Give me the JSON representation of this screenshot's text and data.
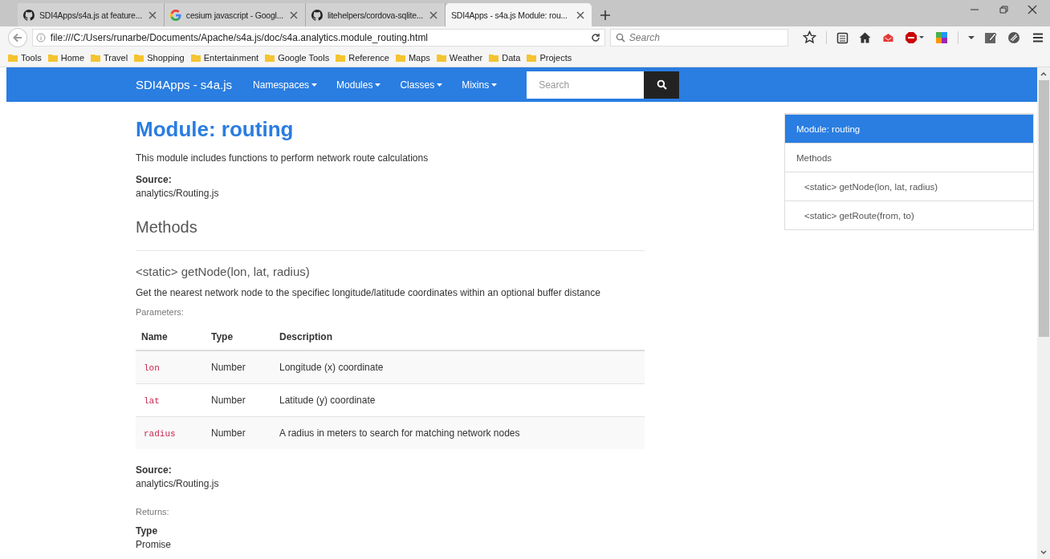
{
  "browser": {
    "tabs": [
      {
        "title": "SDI4Apps/s4a.js at feature...",
        "kind": "github",
        "selected": false
      },
      {
        "title": "cesium javascript - Googl...",
        "kind": "google",
        "selected": false
      },
      {
        "title": "litehelpers/cordova-sqlite...",
        "kind": "github",
        "selected": false
      },
      {
        "title": "SDI4Apps - s4a.js Module: rou...",
        "kind": "none",
        "selected": true
      }
    ],
    "url": "file:///C:/Users/runarbe/Documents/Apache/s4a.js/doc/s4a.analytics.module_routing.html",
    "search_placeholder": "Search",
    "bookmarks": [
      "Tools",
      "Home",
      "Travel",
      "Shopping",
      "Entertainment",
      "Google Tools",
      "Reference",
      "Maps",
      "Weather",
      "Data",
      "Projects"
    ]
  },
  "navbar": {
    "brand": "SDI4Apps - s4a.js",
    "menus": [
      "Namespaces",
      "Modules",
      "Classes",
      "Mixins"
    ],
    "search_placeholder": "Search"
  },
  "article": {
    "title": "Module: routing",
    "description": "This module includes functions to perform network route calculations",
    "source_label": "Source:",
    "source": "analytics/Routing.js",
    "section_title": "Methods",
    "methods": [
      {
        "signature": "<static> getNode(lon, lat, radius)",
        "description": "Get the nearest network node to the specifiec longitude/latitude coordinates within an optional buffer distance",
        "parameters_label": "Parameters:",
        "columns": [
          "Name",
          "Type",
          "Description"
        ],
        "parameters": [
          {
            "name": "lon",
            "type": "Number",
            "description": "Longitude (x) coordinate"
          },
          {
            "name": "lat",
            "type": "Number",
            "description": "Latitude (y) coordinate"
          },
          {
            "name": "radius",
            "type": "Number",
            "description": "A radius in meters to search for matching network nodes"
          }
        ],
        "source_label": "Source:",
        "source": "analytics/Routing.js",
        "returns_label": "Returns:",
        "returns_type_label": "Type",
        "returns_type": "Promise"
      }
    ]
  },
  "toc": {
    "items": [
      {
        "label": "Module: routing",
        "selected": true
      },
      {
        "label": "Methods",
        "selected": false,
        "children": [
          {
            "label": "<static> getNode(lon, lat, radius)",
            "selected": false
          },
          {
            "label": "<static> getRoute(from, to)",
            "selected": false
          }
        ]
      }
    ]
  }
}
